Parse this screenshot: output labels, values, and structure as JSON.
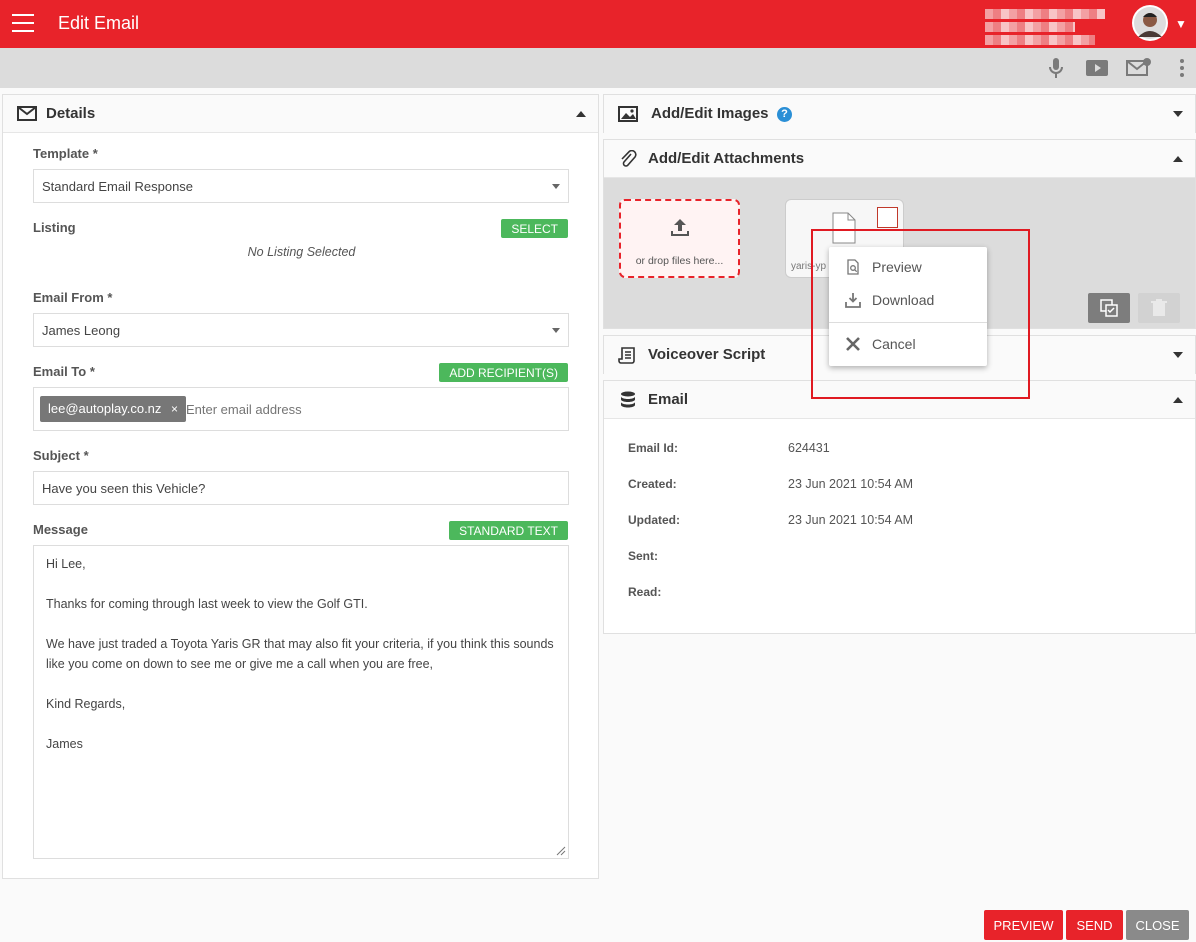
{
  "header": {
    "title": "Edit Email"
  },
  "toolbar": {
    "icons": [
      "microphone-icon",
      "video-icon",
      "email-settings-icon",
      "more-vert-icon"
    ]
  },
  "details": {
    "title": "Details",
    "template": {
      "label": "Template *",
      "value": "Standard Email Response"
    },
    "listing": {
      "label": "Listing",
      "button": "SELECT",
      "empty": "No Listing Selected"
    },
    "email_from": {
      "label": "Email From *",
      "value": "James Leong"
    },
    "email_to": {
      "label": "Email To *",
      "button": "ADD RECIPIENT(S)",
      "chip": "lee@autoplay.co.nz",
      "chip_remove": "×",
      "placeholder": "Enter email address"
    },
    "subject": {
      "label": "Subject *",
      "value": "Have you seen this Vehicle?"
    },
    "message": {
      "label": "Message",
      "button": "STANDARD TEXT",
      "lines": [
        "Hi Lee,",
        "Thanks for coming through last week to view the Golf GTI.",
        "We have just traded a Toyota Yaris GR that may also fit your criteria, if you think this sounds like you come on down to see me or give me a call when you are free,",
        "Kind Regards,",
        "James"
      ]
    }
  },
  "images_panel": {
    "title": "Add/Edit Images"
  },
  "attachments_panel": {
    "title": "Add/Edit Attachments",
    "drop_text": "or drop files here...",
    "file_name": "yaris-yp"
  },
  "context_menu": {
    "items": [
      "Preview",
      "Download",
      "Cancel"
    ]
  },
  "voiceover_panel": {
    "title": "Voiceover Script"
  },
  "email_panel": {
    "title": "Email",
    "fields": [
      {
        "label": "Email Id:",
        "value": "624431"
      },
      {
        "label": "Created:",
        "value": "23 Jun 2021 10:54 AM"
      },
      {
        "label": "Updated:",
        "value": "23 Jun 2021 10:54 AM"
      },
      {
        "label": "Sent:",
        "value": ""
      },
      {
        "label": "Read:",
        "value": ""
      }
    ]
  },
  "footer": {
    "preview": "PREVIEW",
    "send": "SEND",
    "close": "CLOSE"
  },
  "colors": {
    "brand_red": "#e8232a",
    "green": "#4cb85c",
    "grey_button": "#8a8a8a"
  }
}
